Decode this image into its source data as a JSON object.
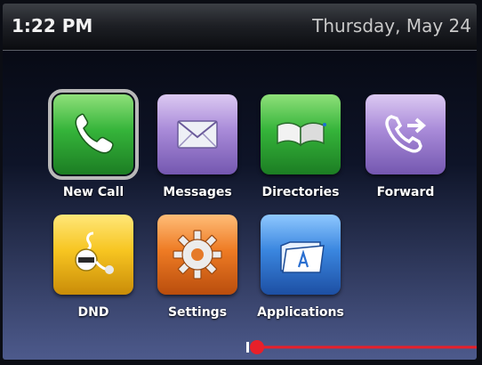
{
  "status_bar": {
    "time": "1:22 PM",
    "date": "Thursday, May 24"
  },
  "apps": [
    {
      "label": "New Call",
      "icon": "phone-handset-icon",
      "color": "#2fae34",
      "selected": true
    },
    {
      "label": "Messages",
      "icon": "envelope-icon",
      "color": "#9a7cd0",
      "selected": false
    },
    {
      "label": "Directories",
      "icon": "open-book-icon",
      "color": "#2fae34",
      "selected": false
    },
    {
      "label": "Forward",
      "icon": "phone-forward-icon",
      "color": "#9a7cd0",
      "selected": false
    },
    {
      "label": "DND",
      "icon": "do-not-disturb-icon",
      "color": "#f4c21e",
      "selected": false
    },
    {
      "label": "Settings",
      "icon": "gear-icon",
      "color": "#ea7424",
      "selected": false
    },
    {
      "label": "Applications",
      "icon": "applications-folder-icon",
      "color": "#2f7fd8",
      "selected": false
    }
  ],
  "page_indicator": {
    "color": "#e8202a"
  }
}
